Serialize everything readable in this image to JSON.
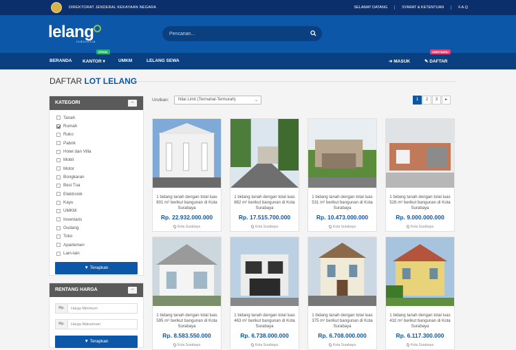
{
  "topbar": {
    "department": "DIREKTORAT JENDERAL KEKAYAAN NEGARA",
    "links": [
      "SELAMAT DATANG",
      "SYARAT & KETENTUAN",
      "F.A.Q"
    ]
  },
  "header": {
    "logo_text": "lelang",
    "logo_sub": "indonesia",
    "search_placeholder": "Pencarian..."
  },
  "nav": {
    "items": [
      "BERANDA",
      "KANTOR",
      "UMKM",
      "LELANG SEWA"
    ],
    "kantor_badge": "KPKNL",
    "login": "MASUK",
    "register": "DAFTAR",
    "register_badge": "USER BARU"
  },
  "page": {
    "title_light": "DAFTAR",
    "title_bold": "LOT LELANG"
  },
  "categories": {
    "heading": "KATEGORI",
    "items": [
      {
        "label": "Tanah",
        "checked": false
      },
      {
        "label": "Rumah",
        "checked": true
      },
      {
        "label": "Ruko",
        "checked": false
      },
      {
        "label": "Pabrik",
        "checked": false
      },
      {
        "label": "Hotel dan Villa",
        "checked": false
      },
      {
        "label": "Mobil",
        "checked": false
      },
      {
        "label": "Motor",
        "checked": false
      },
      {
        "label": "Bongkaran",
        "checked": false
      },
      {
        "label": "Besi Tua",
        "checked": false
      },
      {
        "label": "Elektronik",
        "checked": false
      },
      {
        "label": "Kayu",
        "checked": false
      },
      {
        "label": "UMKM",
        "checked": false
      },
      {
        "label": "Inventaris",
        "checked": false
      },
      {
        "label": "Gudang",
        "checked": false
      },
      {
        "label": "Toko",
        "checked": false
      },
      {
        "label": "Apartemen",
        "checked": false
      },
      {
        "label": "Lain-lain",
        "checked": false
      }
    ],
    "apply_label": "Terapkan"
  },
  "price_range": {
    "heading": "RENTANG HARGA",
    "currency": "Rp.",
    "min_placeholder": "Harga Minimum",
    "max_placeholder": "Harga Maksimum",
    "apply_label": "Terapkan"
  },
  "sort": {
    "label": "Urutkan:",
    "value": "Nilai Limit (Termahal-Termurah)"
  },
  "pagination": [
    "1",
    "2",
    "3",
    "▸"
  ],
  "listings": [
    {
      "desc": "1 bidang tanah dengan total luas 801 m² berikut bangunan di Kota Surabaya",
      "price": "Rp. 22.932.000.000",
      "location": "Kota Surabaya"
    },
    {
      "desc": "1 bidang tanah dengan total luas 882 m² berikut bangunan di Kota Surabaya",
      "price": "Rp. 17.515.700.000",
      "location": "Kota Surabaya"
    },
    {
      "desc": "1 bidang tanah dengan total luas 531 m² berikut bangunan di Kota Surabaya",
      "price": "Rp. 10.473.000.000",
      "location": "Kota Surabaya"
    },
    {
      "desc": "1 bidang tanah dengan total luas 526 m² berikut bangunan di Kota Surabaya",
      "price": "Rp. 9.000.000.000",
      "location": "Kota Surabaya"
    },
    {
      "desc": "1 bidang tanah dengan total luas 595 m² berikut bangunan di Kota Surabaya",
      "price": "Rp. 8.583.550.000",
      "location": "Kota Surabaya"
    },
    {
      "desc": "1 bidang tanah dengan total luas 463 m² berikut bangunan di Kota Surabaya",
      "price": "Rp. 6.738.000.000",
      "location": "Kota Surabaya"
    },
    {
      "desc": "1 bidang tanah dengan total luas 375 m² berikut bangunan di Kota Surabaya",
      "price": "Rp. 6.708.000.000",
      "location": "Kota Surabaya"
    },
    {
      "desc": "1 bidang tanah dengan total luas 432 m² berikut bangunan di Kota Surabaya",
      "price": "Rp. 6.117.300.000",
      "location": "Kota Surabaya"
    }
  ],
  "colors": {
    "brand_dark": "#0b2f6b",
    "brand": "#0d57a8",
    "badge_green": "#21b573",
    "badge_pink": "#e8417a"
  }
}
